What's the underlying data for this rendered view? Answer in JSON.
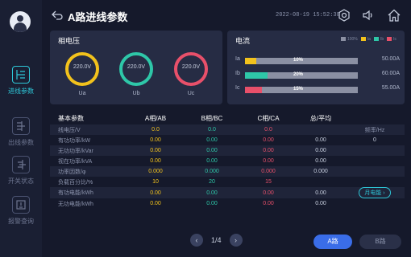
{
  "header": {
    "title": "A路进线参数",
    "datetime": "2022-08-19 15:52:38"
  },
  "sidebar": {
    "items": [
      {
        "label": "进线参数",
        "icon": "incoming-line-icon",
        "active": true
      },
      {
        "label": "出线参数",
        "icon": "outgoing-line-icon",
        "active": false
      },
      {
        "label": "开关状态",
        "icon": "switch-icon",
        "active": false
      },
      {
        "label": "报警查询",
        "icon": "alarm-icon",
        "active": false
      }
    ]
  },
  "phase_voltage": {
    "title": "相电压",
    "gauges": [
      {
        "name": "Ua",
        "value": "220.0V",
        "color": "#f2c21c"
      },
      {
        "name": "Ub",
        "value": "220.0V",
        "color": "#2ec7a8"
      },
      {
        "name": "Uc",
        "value": "220.0V",
        "color": "#e8506a"
      }
    ]
  },
  "current": {
    "title": "电流",
    "legend": [
      {
        "label": "100%",
        "color": "#8b90a3"
      },
      {
        "label": "Ia",
        "color": "#f2c21c"
      },
      {
        "label": "Ib",
        "color": "#2ec7a8"
      },
      {
        "label": "Ic",
        "color": "#e8506a"
      }
    ],
    "bars": [
      {
        "label": "Ia",
        "percent": "10%",
        "fraction": 0.1,
        "max": "50.00A",
        "color": "#f2c21c"
      },
      {
        "label": "Ib",
        "percent": "20%",
        "fraction": 0.2,
        "max": "60.00A",
        "color": "#2ec7a8"
      },
      {
        "label": "Ic",
        "percent": "15%",
        "fraction": 0.15,
        "max": "55.00A",
        "color": "#e8506a"
      }
    ]
  },
  "table": {
    "headers": [
      "基本参数",
      "A相/AB",
      "B相/BC",
      "C相/CA",
      "总/平均",
      ""
    ],
    "rows": [
      {
        "name": "线电压/V",
        "a": "0.0",
        "b": "0.0",
        "c": "0.0",
        "t": "",
        "extra": "频率/Hz"
      },
      {
        "name": "有功功率/kW",
        "a": "0.00",
        "b": "0.00",
        "c": "0.00",
        "t": "0.00",
        "extra": "0"
      },
      {
        "name": "无功功率/kVar",
        "a": "0.00",
        "b": "0.00",
        "c": "0.00",
        "t": "0.00",
        "extra": ""
      },
      {
        "name": "视在功率/kVA",
        "a": "0.00",
        "b": "0.00",
        "c": "0.00",
        "t": "0.00",
        "extra": ""
      },
      {
        "name": "功率因数/φ",
        "a": "0.000",
        "b": "0.000",
        "c": "0.000",
        "t": "0.000",
        "extra": ""
      },
      {
        "name": "负载百分比/%",
        "a": "10",
        "b": "20",
        "c": "15",
        "t": "",
        "extra": ""
      },
      {
        "name": "有功电能/kWh",
        "a": "0.00",
        "b": "0.00",
        "c": "0.00",
        "t": "0.00",
        "extra": "月电能 ›"
      },
      {
        "name": "无功电能/kWh",
        "a": "0.00",
        "b": "0.00",
        "c": "0.00",
        "t": "0.00",
        "extra": ""
      }
    ]
  },
  "pager": {
    "prev": "‹",
    "page": "1/4",
    "next": "›"
  },
  "route_buttons": {
    "a": "A路",
    "b": "B路"
  }
}
